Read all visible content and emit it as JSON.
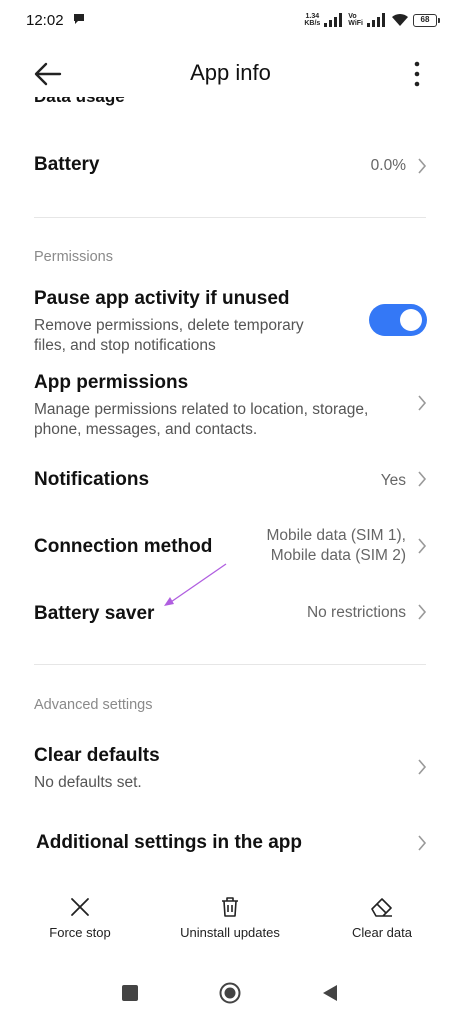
{
  "status_bar": {
    "time": "12:02",
    "speed_value": "1.34",
    "speed_unit": "KB/s",
    "vo_top": "Vo",
    "vo_bottom": "WiFi",
    "battery": "68"
  },
  "header": {
    "title": "App info",
    "back_icon": "arrow-left-icon",
    "more_icon": "more-vertical-icon"
  },
  "rows": {
    "cut_off": {
      "title": "Data usage"
    },
    "battery": {
      "title": "Battery",
      "value": "0.0%"
    },
    "pause_app": {
      "title": "Pause app activity if unused",
      "subtitle": "Remove permissions, delete temporary files, and stop notifications",
      "toggle_on": true
    },
    "app_permissions": {
      "title": "App permissions",
      "subtitle": "Manage permissions related to location, storage, phone, messages, and contacts."
    },
    "notifications": {
      "title": "Notifications",
      "value": "Yes"
    },
    "connection_method": {
      "title": "Connection method",
      "value_line1": "Mobile data (SIM 1),",
      "value_line2": "Mobile data (SIM 2)"
    },
    "battery_saver": {
      "title": "Battery saver",
      "value": "No restrictions"
    },
    "clear_defaults": {
      "title": "Clear defaults",
      "subtitle": "No defaults set."
    },
    "additional_settings": {
      "title": "Additional settings in the app"
    }
  },
  "sections": {
    "permissions": "Permissions",
    "advanced": "Advanced settings"
  },
  "actions": {
    "force_stop": "Force stop",
    "uninstall_updates": "Uninstall updates",
    "clear_data": "Clear data"
  },
  "colors": {
    "accent": "#3478f6",
    "annotation": "#b05ee0"
  }
}
